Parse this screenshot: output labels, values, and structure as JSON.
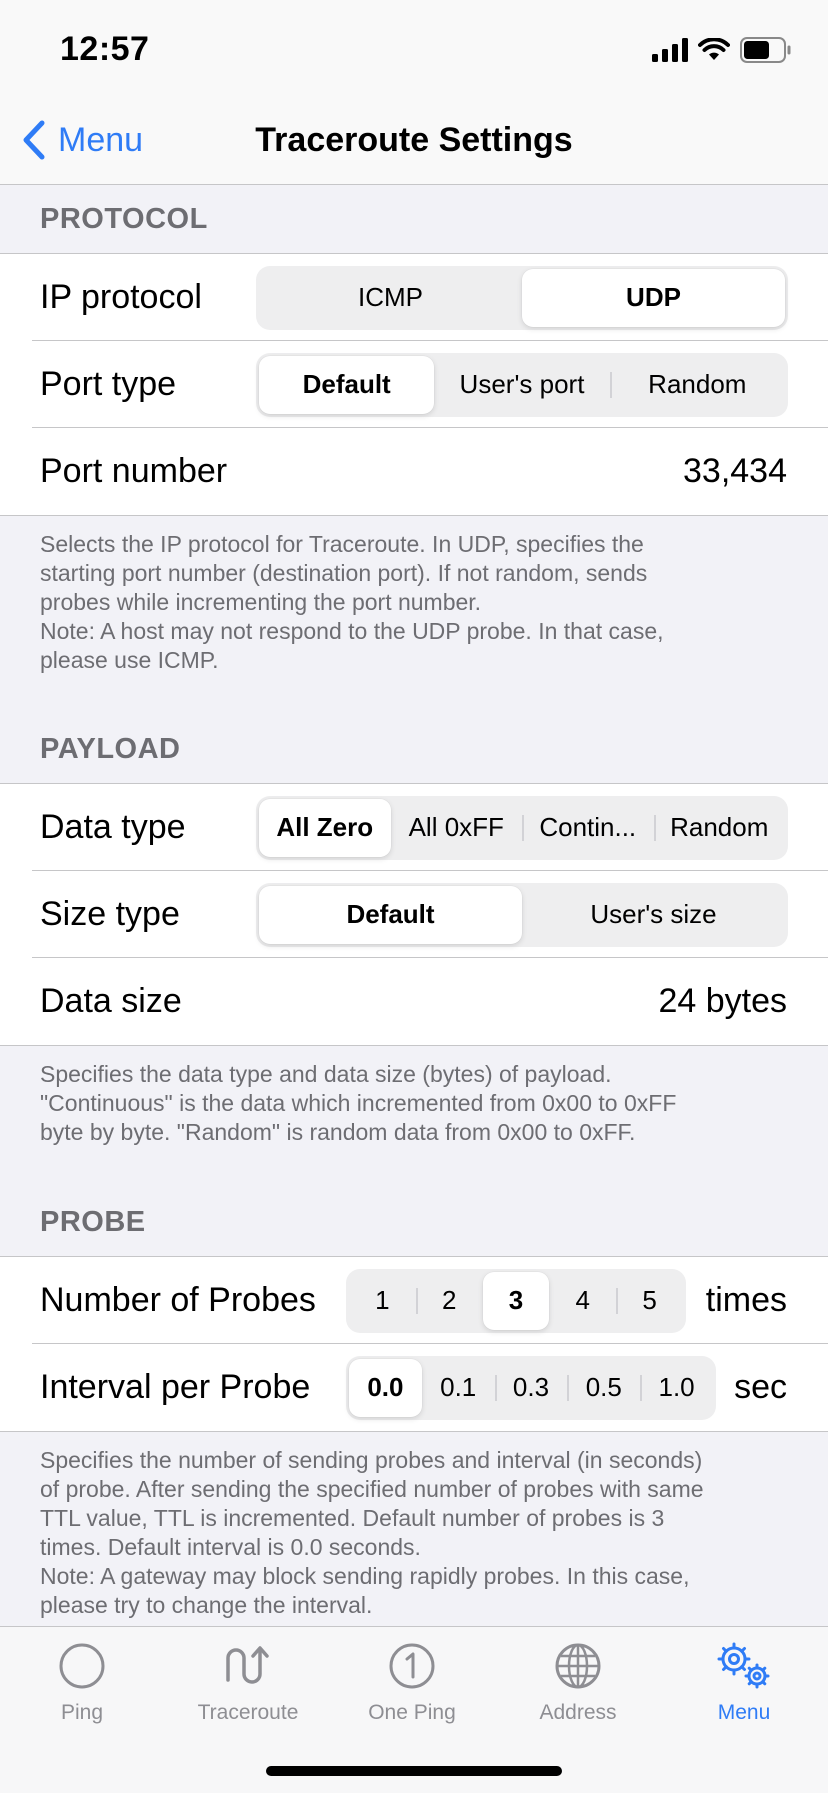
{
  "status_bar": {
    "time": "12:57"
  },
  "nav": {
    "back_label": "Menu",
    "title": "Traceroute Settings"
  },
  "protocol": {
    "header": "PROTOCOL",
    "ip_protocol": {
      "label": "IP protocol",
      "options": [
        "ICMP",
        "UDP"
      ],
      "selected": "UDP"
    },
    "port_type": {
      "label": "Port type",
      "options": [
        "Default",
        "User's port",
        "Random"
      ],
      "selected": "Default"
    },
    "port_number": {
      "label": "Port number",
      "value": "33,434"
    },
    "note_lines": [
      "Selects the IP protocol for Traceroute. In UDP, specifies the",
      "starting port number (destination port). If not random, sends",
      "probes while incrementing the port number.",
      "Note: A host may not respond to the UDP probe. In that case,",
      "please use ICMP."
    ]
  },
  "payload": {
    "header": "PAYLOAD",
    "data_type": {
      "label": "Data type",
      "options": [
        "All Zero",
        "All 0xFF",
        "Contin...",
        "Random"
      ],
      "selected": "All Zero"
    },
    "size_type": {
      "label": "Size type",
      "options": [
        "Default",
        "User's size"
      ],
      "selected": "Default"
    },
    "data_size": {
      "label": "Data size",
      "value": "24 bytes"
    },
    "note_lines": [
      "Specifies the data type and data size (bytes) of payload.",
      "\"Continuous\" is the data which incremented from 0x00 to 0xFF",
      "byte by byte. \"Random\" is random data from 0x00 to 0xFF."
    ]
  },
  "probe": {
    "header": "PROBE",
    "number_of_probes": {
      "label": "Number of Probes",
      "options": [
        "1",
        "2",
        "3",
        "4",
        "5"
      ],
      "selected": "3",
      "unit": "times"
    },
    "interval_per_probe": {
      "label": "Interval per Probe",
      "options": [
        "0.0",
        "0.1",
        "0.3",
        "0.5",
        "1.0"
      ],
      "selected": "0.0",
      "unit": "sec"
    },
    "note_lines": [
      "Specifies the number of sending probes and interval (in seconds)",
      "of probe. After sending the specified number of probes with same",
      "TTL value, TTL is incremented. Default number of probes is 3",
      "times. Default interval is 0.0 seconds.",
      "Note: A gateway may block sending rapidly probes. In this case,",
      "please try to change the interval."
    ]
  },
  "tab_bar": {
    "tabs": [
      {
        "label": "Ping",
        "icon": "circle-icon"
      },
      {
        "label": "Traceroute",
        "icon": "traceroute-arrows-icon"
      },
      {
        "label": "One Ping",
        "icon": "one-circle-icon"
      },
      {
        "label": "Address",
        "icon": "globe-icon"
      },
      {
        "label": "Menu",
        "icon": "gears-icon"
      }
    ],
    "active": "Menu"
  },
  "colors": {
    "accent": "#2f7cf6",
    "inactive": "#8e8e93",
    "background": "#f2f2f7"
  }
}
